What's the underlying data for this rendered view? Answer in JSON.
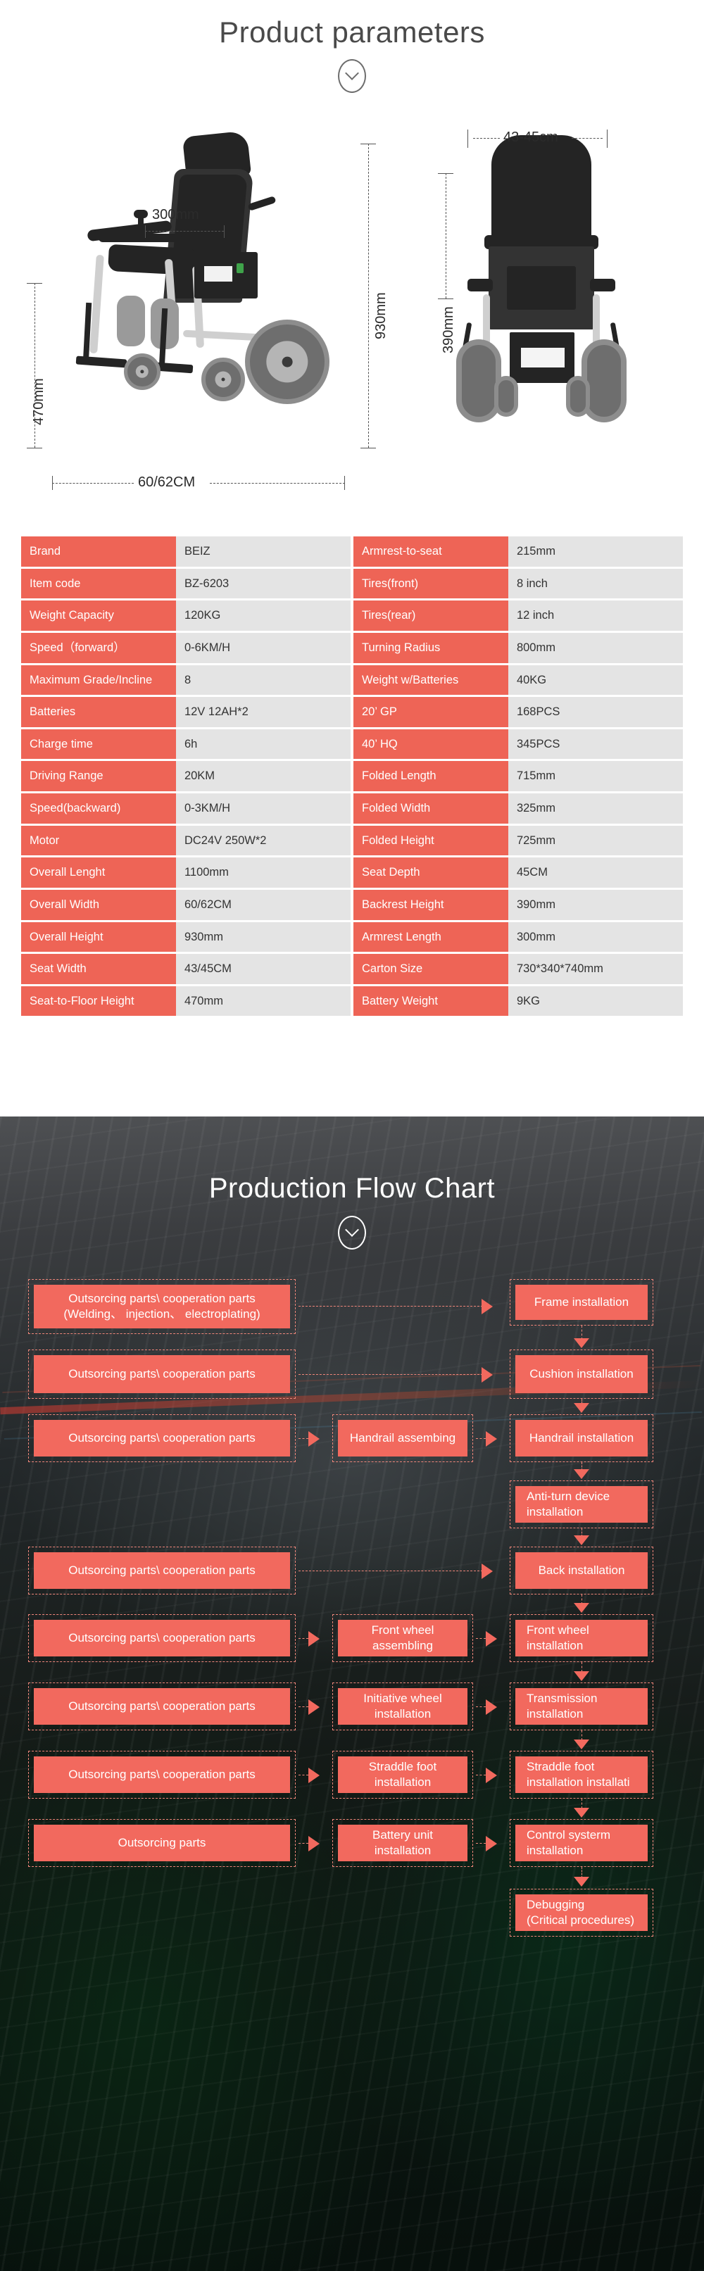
{
  "section1": {
    "title": "Product parameters",
    "scroll_icon": "chevron-down-icon",
    "diagram": {
      "side_view": {
        "armrest_length": "300mm",
        "overall_height": "930mm",
        "seat_to_floor": "470mm",
        "overall_width": "60/62CM"
      },
      "front_view": {
        "seat_width": "43-45cm",
        "backrest_height": "390mm"
      }
    },
    "spec_table": {
      "left": [
        {
          "key": "Brand",
          "value": "BEIZ"
        },
        {
          "key": "Item code",
          "value": "BZ-6203"
        },
        {
          "key": "Weight Capacity",
          "value": "120KG"
        },
        {
          "key": "Speed（forward）",
          "value": "0-6KM/H"
        },
        {
          "key": "Maximum Grade/Incline",
          "value": "8"
        },
        {
          "key": "Batteries",
          "value": "12V 12AH*2"
        },
        {
          "key": "Charge time",
          "value": "6h"
        },
        {
          "key": "Driving Range",
          "value": "20KM"
        },
        {
          "key": "Speed(backward)",
          "value": "0-3KM/H"
        },
        {
          "key": "Motor",
          "value": "DC24V 250W*2"
        },
        {
          "key": "Overall Lenght",
          "value": "1100mm"
        },
        {
          "key": "Overall Width",
          "value": "60/62CM"
        },
        {
          "key": "Overall Height",
          "value": "930mm"
        },
        {
          "key": "Seat  Width",
          "value": "43/45CM"
        },
        {
          "key": "Seat-to-Floor Height",
          "value": "470mm"
        }
      ],
      "right": [
        {
          "key": "Armrest-to-seat",
          "value": "215mm"
        },
        {
          "key": "Tires(front)",
          "value": "8 inch"
        },
        {
          "key": "Tires(rear)",
          "value": "12 inch"
        },
        {
          "key": "Turning Radius",
          "value": "800mm"
        },
        {
          "key": "Weight w/Batteries",
          "value": "40KG"
        },
        {
          "key": "20’  GP",
          "value": "168PCS"
        },
        {
          "key": "40’  HQ",
          "value": "345PCS"
        },
        {
          "key": "Folded Length",
          "value": "715mm"
        },
        {
          "key": "Folded Width",
          "value": "325mm"
        },
        {
          "key": "Folded Height",
          "value": "725mm"
        },
        {
          "key": "Seat Depth",
          "value": "45CM"
        },
        {
          "key": "Backrest Height",
          "value": "390mm"
        },
        {
          "key": "Armrest Length",
          "value": "300mm"
        },
        {
          "key": "Carton Size",
          "value": "730*340*740mm"
        },
        {
          "key": "Battery Weight",
          "value": "9KG"
        }
      ]
    }
  },
  "section2": {
    "title": "Production Flow Chart",
    "scroll_icon": "chevron-down-icon",
    "nodes": {
      "l1": "Outsorcing parts\\ cooperation parts\n(Welding、 injection、 electroplating)",
      "l2": "Outsorcing parts\\ cooperation parts",
      "l3": "Outsorcing parts\\ cooperation parts",
      "l4": "Outsorcing parts\\ cooperation parts",
      "l5": "Outsorcing parts\\ cooperation parts",
      "l6": "Outsorcing parts\\ cooperation parts",
      "l7": "Outsorcing parts\\ cooperation parts",
      "l8": "Outsorcing parts",
      "m3": "Handrail assembing",
      "m6": "Front wheel\nassembling",
      "m7": "Initiative wheel\ninstallation",
      "m8": "Straddle foot\ninstallation",
      "m9": "Battery unit\ninstallation",
      "r1": "Frame installation",
      "r2": "Cushion installation",
      "r3": "Handrail installation",
      "r4": "Anti-turn device\ninstallation",
      "r5": "Back installation",
      "r6": "Front wheel\ninstallation",
      "r7": "Transmission\ninstallation",
      "r8": "Straddle foot\ninstallation installati",
      "r9": "Control systerm\ninstallation",
      "r10": "Debugging\n(Critical procedures)"
    }
  },
  "colors": {
    "accent_red": "#f2695e",
    "table_key_bg": "#ee6456",
    "table_val_bg": "#e4e4e4",
    "title_gray": "#4a4a4a"
  }
}
